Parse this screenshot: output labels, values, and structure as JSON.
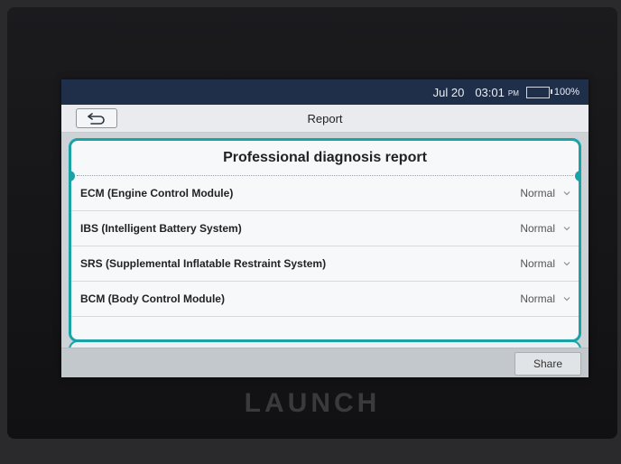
{
  "statusbar": {
    "date": "Jul 20",
    "time": "03:01",
    "ampm": "PM",
    "battery": "100%",
    "battery_level": 1.0,
    "battery_color": "#2ecc40"
  },
  "titlebar": {
    "title": "Report",
    "back_icon": "back-arrow-icon"
  },
  "report": {
    "heading": "Professional diagnosis report",
    "rows": [
      {
        "name": "ECM (Engine Control Module)",
        "status": "Normal"
      },
      {
        "name": "IBS (Intelligent Battery System)",
        "status": "Normal"
      },
      {
        "name": "SRS (Supplemental Inflatable Restraint System)",
        "status": "Normal"
      },
      {
        "name": "BCM (Body Control Module)",
        "status": "Normal"
      }
    ]
  },
  "footer": {
    "share_label": "Share"
  },
  "device": {
    "brand": "LAUNCH"
  },
  "colors": {
    "accent": "#1aa3a7",
    "statusbar_bg": "#1f2f49"
  }
}
